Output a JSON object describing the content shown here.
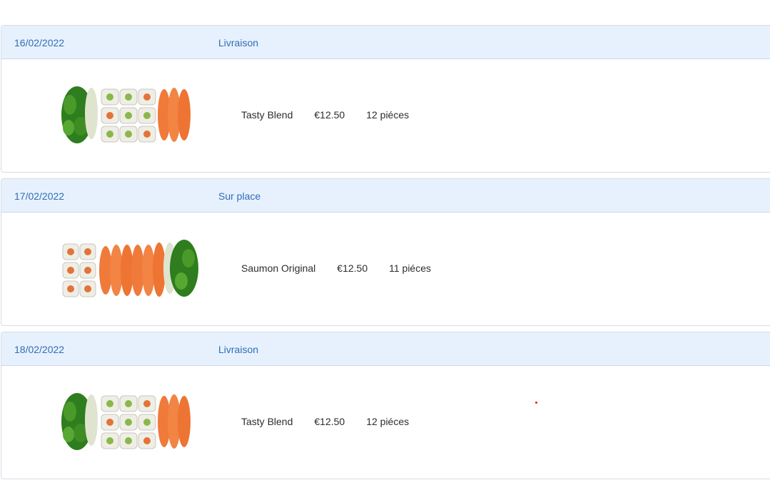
{
  "orders": [
    {
      "date": "16/02/2022",
      "mode": "Livraison",
      "product": "Tasty Blend",
      "price": "€12.50",
      "pieces": "12 piéces",
      "image_icon": "sushi-platter-icon"
    },
    {
      "date": "17/02/2022",
      "mode": "Sur place",
      "product": "Saumon Original",
      "price": "€12.50",
      "pieces": "11 piéces",
      "image_icon": "sushi-platter-icon"
    },
    {
      "date": "18/02/2022",
      "mode": "Livraison",
      "product": "Tasty Blend",
      "price": "€12.50",
      "pieces": "12 piéces",
      "image_icon": "sushi-platter-icon"
    }
  ],
  "colors": {
    "header_bg": "#e7f1fe",
    "header_text": "#2f6db5",
    "salmon": "#f07a3a",
    "rice": "#f1f0ea",
    "leaf": "#2e7d1e"
  }
}
